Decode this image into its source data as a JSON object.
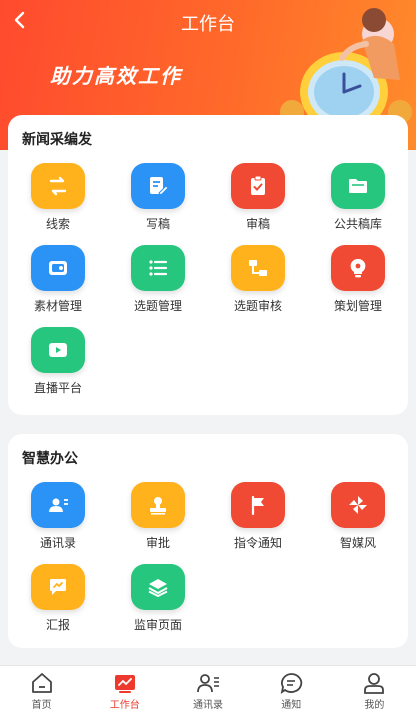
{
  "header": {
    "title": "工作台",
    "slogan": "助力高效工作",
    "back_icon": "chevron-left-icon"
  },
  "sections": [
    {
      "title": "新闻采编发",
      "items": [
        {
          "label": "线索",
          "icon": "clue-icon",
          "color": "#ffb21c"
        },
        {
          "label": "写稿",
          "icon": "edit-document-icon",
          "color": "#2b93f5"
        },
        {
          "label": "审稿",
          "icon": "review-clipboard-icon",
          "color": "#f04a34"
        },
        {
          "label": "公共稿库",
          "icon": "folder-icon",
          "color": "#27c67f"
        },
        {
          "label": "素材管理",
          "icon": "image-folder-icon",
          "color": "#2b93f5"
        },
        {
          "label": "选题管理",
          "icon": "list-icon",
          "color": "#27c67f"
        },
        {
          "label": "选题审核",
          "icon": "flow-icon",
          "color": "#ffb21c"
        },
        {
          "label": "策划管理",
          "icon": "lightbulb-icon",
          "color": "#f04a34"
        },
        {
          "label": "直播平台",
          "icon": "live-play-icon",
          "color": "#27c67f"
        }
      ]
    },
    {
      "title": "智慧办公",
      "items": [
        {
          "label": "通讯录",
          "icon": "contacts-icon",
          "color": "#2b93f5"
        },
        {
          "label": "审批",
          "icon": "stamp-icon",
          "color": "#ffb21c"
        },
        {
          "label": "指令通知",
          "icon": "flag-icon",
          "color": "#f04a34"
        },
        {
          "label": "智媒风",
          "icon": "pinwheel-icon",
          "color": "#f04a34"
        },
        {
          "label": "汇报",
          "icon": "report-icon",
          "color": "#ffb21c"
        },
        {
          "label": "监审页面",
          "icon": "layers-icon",
          "color": "#27c67f"
        }
      ]
    }
  ],
  "tabs": [
    {
      "label": "首页",
      "icon": "home-icon",
      "active": false
    },
    {
      "label": "工作台",
      "icon": "workbench-icon",
      "active": true
    },
    {
      "label": "通讯录",
      "icon": "contacts-icon",
      "active": false
    },
    {
      "label": "通知",
      "icon": "message-icon",
      "active": false
    },
    {
      "label": "我的",
      "icon": "user-icon",
      "active": false
    }
  ],
  "colors": {
    "accent": "#ee3a2e",
    "header_start": "#ff4a2e",
    "header_end": "#ff8b2b"
  }
}
